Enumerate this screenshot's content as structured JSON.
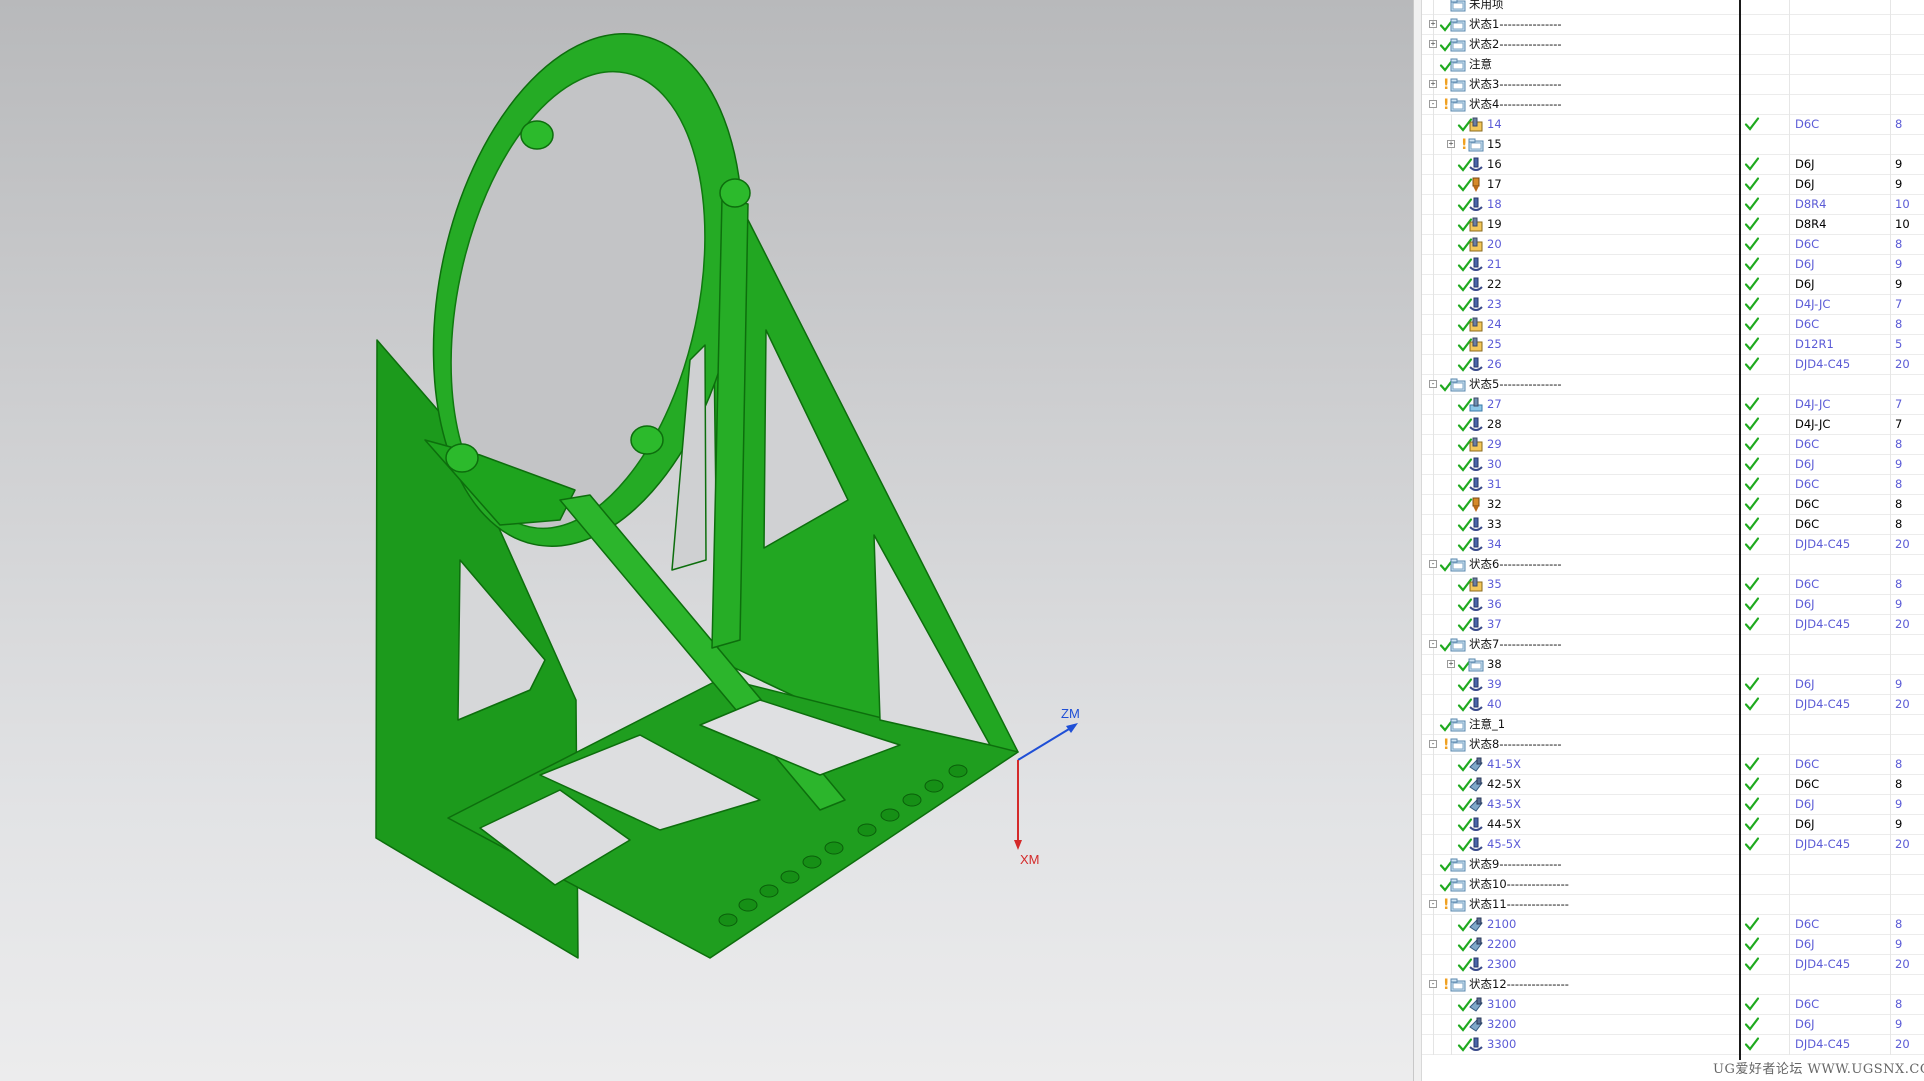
{
  "viewport": {
    "triad": {
      "zm_label": "ZM",
      "xm_label": "XM"
    },
    "colors": {
      "part": "#1fa01f",
      "zm": "#1f4fd6",
      "xm": "#d42a2a"
    }
  },
  "navigator": {
    "rows": [
      {
        "level": 0,
        "expander": "none",
        "status": "none",
        "icon": "folder-icon",
        "name": "未用项",
        "blue": false
      },
      {
        "level": 0,
        "expander": "+",
        "status": "check",
        "icon": "folder-icon",
        "name": "状态1---------------",
        "blue": false
      },
      {
        "level": 0,
        "expander": "+",
        "status": "check",
        "icon": "folder-icon",
        "name": "状态2---------------",
        "blue": false
      },
      {
        "level": 0,
        "expander": "none",
        "status": "check",
        "icon": "folder-icon",
        "name": "注意",
        "blue": false
      },
      {
        "level": 0,
        "expander": "+",
        "status": "warn",
        "icon": "folder-icon",
        "name": "状态3---------------",
        "blue": false
      },
      {
        "level": 0,
        "expander": "-",
        "status": "warn",
        "icon": "folder-icon",
        "name": "状态4---------------",
        "blue": false
      },
      {
        "level": 1,
        "expander": "none",
        "status": "check",
        "icon": "cavity-mill-icon",
        "name": "14",
        "blue": true,
        "gen": true,
        "tool": "D6C",
        "num": "8"
      },
      {
        "level": 1,
        "expander": "+",
        "status": "warn",
        "icon": "folder-icon",
        "name": "15",
        "blue": false
      },
      {
        "level": 1,
        "expander": "none",
        "status": "check",
        "icon": "zlevel-icon",
        "name": "16",
        "blue": false,
        "gen": true,
        "tool": "D6J",
        "num": "9"
      },
      {
        "level": 1,
        "expander": "none",
        "status": "check",
        "icon": "drill-icon",
        "name": "17",
        "blue": false,
        "gen": true,
        "tool": "D6J",
        "num": "9"
      },
      {
        "level": 1,
        "expander": "none",
        "status": "check",
        "icon": "zlevel-icon",
        "name": "18",
        "blue": true,
        "gen": true,
        "tool": "D8R4",
        "num": "10"
      },
      {
        "level": 1,
        "expander": "none",
        "status": "check",
        "icon": "cavity-mill-icon",
        "name": "19",
        "blue": false,
        "gen": true,
        "tool": "D8R4",
        "num": "10"
      },
      {
        "level": 1,
        "expander": "none",
        "status": "check",
        "icon": "cavity-mill-icon",
        "name": "20",
        "blue": true,
        "gen": true,
        "tool": "D6C",
        "num": "8"
      },
      {
        "level": 1,
        "expander": "none",
        "status": "check",
        "icon": "zlevel-icon",
        "name": "21",
        "blue": true,
        "gen": true,
        "tool": "D6J",
        "num": "9"
      },
      {
        "level": 1,
        "expander": "none",
        "status": "check",
        "icon": "zlevel-icon",
        "name": "22",
        "blue": false,
        "gen": true,
        "tool": "D6J",
        "num": "9"
      },
      {
        "level": 1,
        "expander": "none",
        "status": "check",
        "icon": "zlevel-icon",
        "name": "23",
        "blue": true,
        "gen": true,
        "tool": "D4J-JC",
        "num": "7"
      },
      {
        "level": 1,
        "expander": "none",
        "status": "check",
        "icon": "cavity-mill-icon",
        "name": "24",
        "blue": true,
        "gen": true,
        "tool": "D6C",
        "num": "8"
      },
      {
        "level": 1,
        "expander": "none",
        "status": "check",
        "icon": "cavity-mill-icon",
        "name": "25",
        "blue": true,
        "gen": true,
        "tool": "D12R1",
        "num": "5"
      },
      {
        "level": 1,
        "expander": "none",
        "status": "check",
        "icon": "zlevel-icon",
        "name": "26",
        "blue": true,
        "gen": true,
        "tool": "DJD4-C45",
        "num": "20"
      },
      {
        "level": 0,
        "expander": "-",
        "status": "check",
        "icon": "folder-icon",
        "name": "状态5---------------",
        "blue": false
      },
      {
        "level": 1,
        "expander": "none",
        "status": "check",
        "icon": "planar-mill-icon",
        "name": "27",
        "blue": true,
        "gen": true,
        "tool": "D4J-JC",
        "num": "7"
      },
      {
        "level": 1,
        "expander": "none",
        "status": "check",
        "icon": "zlevel-icon",
        "name": "28",
        "blue": false,
        "gen": true,
        "tool": "D4J-JC",
        "num": "7"
      },
      {
        "level": 1,
        "expander": "none",
        "status": "check",
        "icon": "cavity-mill-icon",
        "name": "29",
        "blue": true,
        "gen": true,
        "tool": "D6C",
        "num": "8"
      },
      {
        "level": 1,
        "expander": "none",
        "status": "check",
        "icon": "zlevel-icon",
        "name": "30",
        "blue": true,
        "gen": true,
        "tool": "D6J",
        "num": "9"
      },
      {
        "level": 1,
        "expander": "none",
        "status": "check",
        "icon": "zlevel-icon",
        "name": "31",
        "blue": true,
        "gen": true,
        "tool": "D6C",
        "num": "8"
      },
      {
        "level": 1,
        "expander": "none",
        "status": "check",
        "icon": "drill-icon",
        "name": "32",
        "blue": false,
        "gen": true,
        "tool": "D6C",
        "num": "8"
      },
      {
        "level": 1,
        "expander": "none",
        "status": "check",
        "icon": "zlevel-icon",
        "name": "33",
        "blue": false,
        "gen": true,
        "tool": "D6C",
        "num": "8"
      },
      {
        "level": 1,
        "expander": "none",
        "status": "check",
        "icon": "zlevel-icon",
        "name": "34",
        "blue": true,
        "gen": true,
        "tool": "DJD4-C45",
        "num": "20"
      },
      {
        "level": 0,
        "expander": "-",
        "status": "check",
        "icon": "folder-icon",
        "name": "状态6---------------",
        "blue": false
      },
      {
        "level": 1,
        "expander": "none",
        "status": "check",
        "icon": "cavity-mill-icon",
        "name": "35",
        "blue": true,
        "gen": true,
        "tool": "D6C",
        "num": "8"
      },
      {
        "level": 1,
        "expander": "none",
        "status": "check",
        "icon": "zlevel-icon",
        "name": "36",
        "blue": true,
        "gen": true,
        "tool": "D6J",
        "num": "9"
      },
      {
        "level": 1,
        "expander": "none",
        "status": "check",
        "icon": "zlevel-icon",
        "name": "37",
        "blue": true,
        "gen": true,
        "tool": "DJD4-C45",
        "num": "20"
      },
      {
        "level": 0,
        "expander": "-",
        "status": "check",
        "icon": "folder-icon",
        "name": "状态7---------------",
        "blue": false
      },
      {
        "level": 1,
        "expander": "+",
        "status": "check",
        "icon": "folder-icon",
        "name": "38",
        "blue": false
      },
      {
        "level": 1,
        "expander": "none",
        "status": "check",
        "icon": "zlevel-icon",
        "name": "39",
        "blue": true,
        "gen": true,
        "tool": "D6J",
        "num": "9"
      },
      {
        "level": 1,
        "expander": "none",
        "status": "check",
        "icon": "zlevel-icon",
        "name": "40",
        "blue": true,
        "gen": true,
        "tool": "DJD4-C45",
        "num": "20"
      },
      {
        "level": 0,
        "expander": "none",
        "status": "check",
        "icon": "folder-icon",
        "name": "注意_1",
        "blue": false
      },
      {
        "level": 0,
        "expander": "-",
        "status": "warn",
        "icon": "folder-icon",
        "name": "状态8---------------",
        "blue": false
      },
      {
        "level": 1,
        "expander": "none",
        "status": "check",
        "icon": "5axis-icon",
        "name": "41-5X",
        "blue": true,
        "gen": true,
        "tool": "D6C",
        "num": "8"
      },
      {
        "level": 1,
        "expander": "none",
        "status": "check",
        "icon": "5axis-icon",
        "name": "42-5X",
        "blue": false,
        "gen": true,
        "tool": "D6C",
        "num": "8"
      },
      {
        "level": 1,
        "expander": "none",
        "status": "check",
        "icon": "5axis-icon",
        "name": "43-5X",
        "blue": true,
        "gen": true,
        "tool": "D6J",
        "num": "9"
      },
      {
        "level": 1,
        "expander": "none",
        "status": "check",
        "icon": "zlevel-icon",
        "name": "44-5X",
        "blue": false,
        "gen": true,
        "tool": "D6J",
        "num": "9"
      },
      {
        "level": 1,
        "expander": "none",
        "status": "check",
        "icon": "zlevel-icon",
        "name": "45-5X",
        "blue": true,
        "gen": true,
        "tool": "DJD4-C45",
        "num": "20"
      },
      {
        "level": 0,
        "expander": "none",
        "status": "check",
        "icon": "folder-icon",
        "name": "状态9---------------",
        "blue": false
      },
      {
        "level": 0,
        "expander": "none",
        "status": "check",
        "icon": "folder-icon",
        "name": "状态10---------------",
        "blue": false
      },
      {
        "level": 0,
        "expander": "-",
        "status": "warn",
        "icon": "folder-icon",
        "name": "状态11---------------",
        "blue": false
      },
      {
        "level": 1,
        "expander": "none",
        "status": "check",
        "icon": "5axis-icon",
        "name": "2100",
        "blue": true,
        "gen": true,
        "tool": "D6C",
        "num": "8"
      },
      {
        "level": 1,
        "expander": "none",
        "status": "check",
        "icon": "5axis-icon",
        "name": "2200",
        "blue": true,
        "gen": true,
        "tool": "D6J",
        "num": "9"
      },
      {
        "level": 1,
        "expander": "none",
        "status": "check",
        "icon": "zlevel-icon",
        "name": "2300",
        "blue": true,
        "gen": true,
        "tool": "DJD4-C45",
        "num": "20"
      },
      {
        "level": 0,
        "expander": "-",
        "status": "warn",
        "icon": "folder-icon",
        "name": "状态12---------------",
        "blue": false
      },
      {
        "level": 1,
        "expander": "none",
        "status": "check",
        "icon": "5axis-icon",
        "name": "3100",
        "blue": true,
        "gen": true,
        "tool": "D6C",
        "num": "8"
      },
      {
        "level": 1,
        "expander": "none",
        "status": "check",
        "icon": "5axis-icon",
        "name": "3200",
        "blue": true,
        "gen": true,
        "tool": "D6J",
        "num": "9"
      },
      {
        "level": 1,
        "expander": "none",
        "status": "check",
        "icon": "zlevel-icon",
        "name": "3300",
        "blue": true,
        "gen": true,
        "tool": "DJD4-C45",
        "num": "20"
      }
    ]
  },
  "watermark": "UG爱好者论坛 WWW.UGSNX.COM"
}
